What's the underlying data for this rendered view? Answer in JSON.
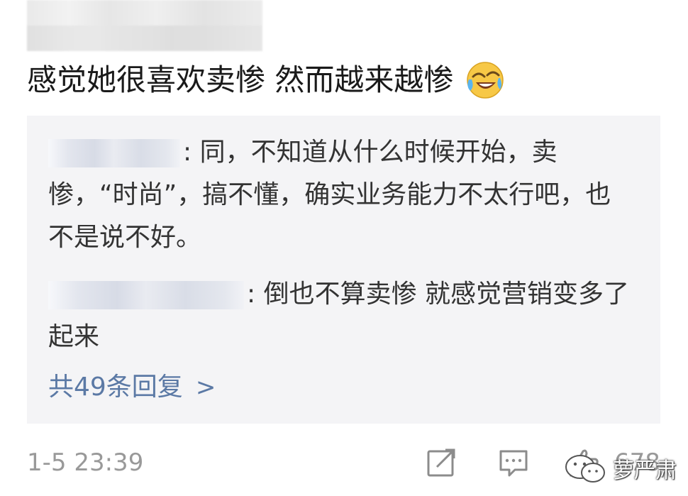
{
  "comment": {
    "text": "感觉她很喜欢卖惨 然而越来越惨",
    "emoji": "laughing-crying-face-icon"
  },
  "replies": [
    {
      "text": ": 同，不知道从什么时候开始，卖惨，“时尚”，搞不懂，确实业务能力不太行吧，也不是说不好。"
    },
    {
      "text": ": 倒也不算卖惨 就感觉营销变多了起来"
    }
  ],
  "more_replies": {
    "label": "共49条回复",
    "chevron": ">"
  },
  "footer": {
    "timestamp": "1-5 23:39",
    "like_count": "678"
  },
  "watermark": {
    "text": "萝严肃"
  },
  "colors": {
    "link": "#5b79a5",
    "reply_bg": "#f4f4f6",
    "meta_gray": "#999999",
    "text": "#1a1a1a"
  }
}
